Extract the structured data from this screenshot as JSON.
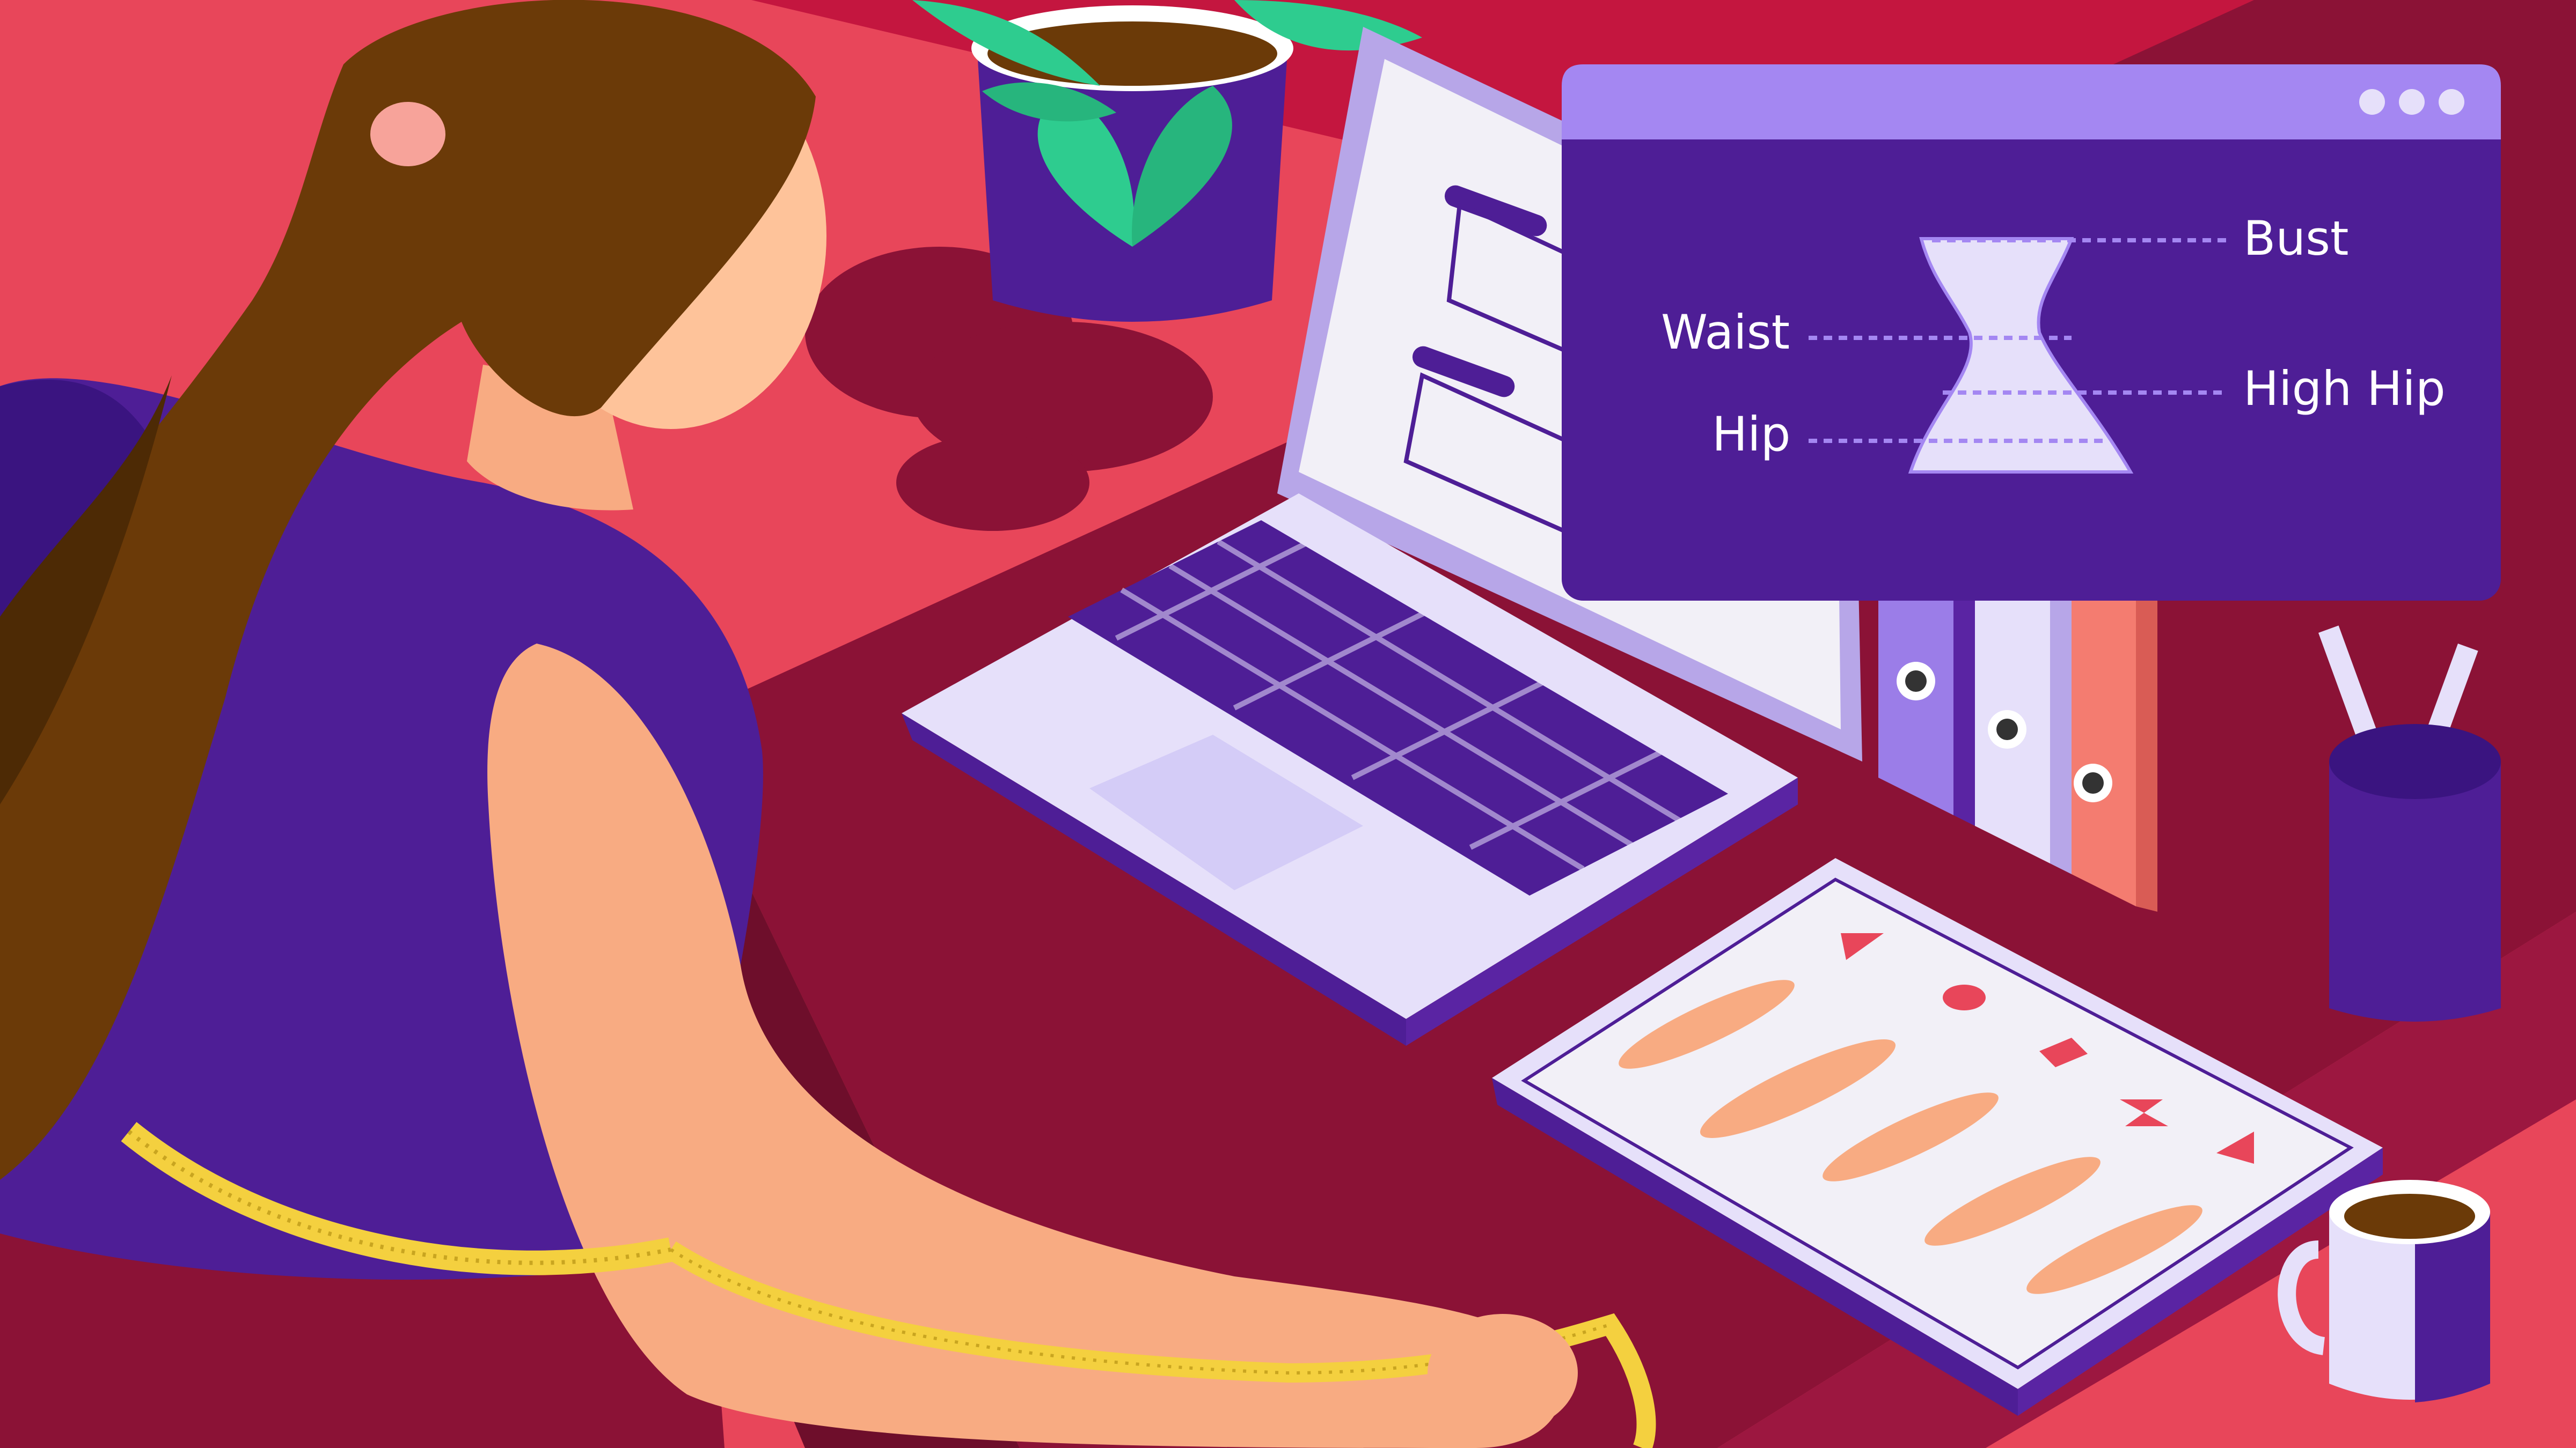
{
  "colors": {
    "background": "#e8465a",
    "desk": "#8b1236",
    "window_frame": "#4e1e96",
    "window_titlebar": "#a487f2",
    "accent_purple": "#5a24a3",
    "laptop_body": "#e6e0fa",
    "tape_yellow": "#f4d03f",
    "skin": "#f8ab82",
    "hair": "#6b3a08"
  },
  "window": {
    "icons": [
      "window-dot-icon",
      "window-dot-icon",
      "window-dot-icon"
    ],
    "labels": {
      "bust": "Bust",
      "waist": "Waist",
      "high_hip": "High Hip",
      "hip": "Hip"
    }
  },
  "tablet": {
    "shape_icons": [
      "triangle-icon",
      "circle-icon",
      "rectangle-icon",
      "hourglass-icon",
      "inverted-triangle-icon"
    ]
  }
}
